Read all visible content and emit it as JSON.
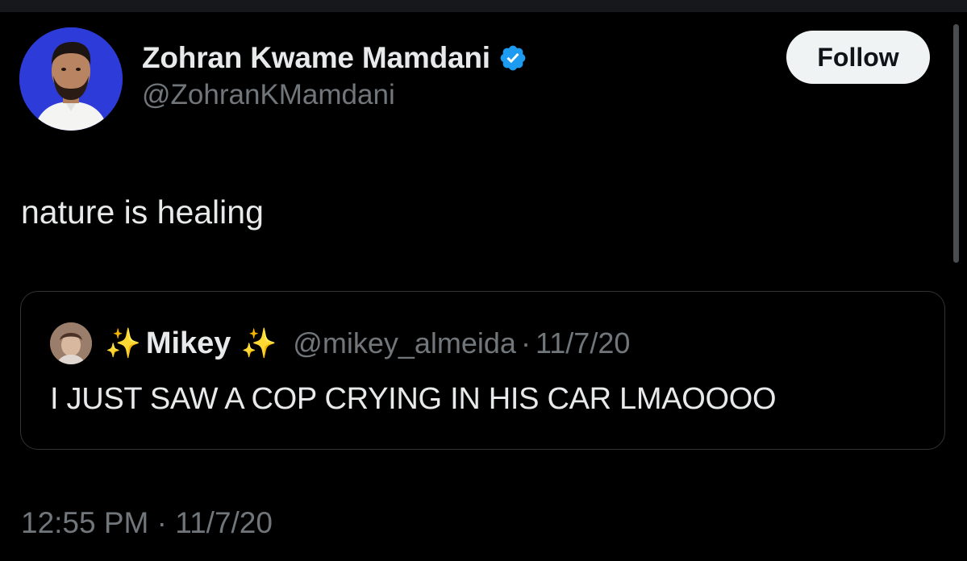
{
  "tweet": {
    "author": {
      "display_name": "Zohran Kwame Mamdani",
      "handle": "@ZohranKMamdani",
      "verified_icon": "verified-badge-icon"
    },
    "follow_label": "Follow",
    "text": "nature is healing",
    "quoted": {
      "sparkle_left": "✨",
      "display_name": "Mikey",
      "sparkle_right": "✨",
      "handle": "@mikey_almeida",
      "separator": "·",
      "date": "11/7/20",
      "text": "I JUST SAW A COP CRYING IN HIS CAR LMAOOOO"
    },
    "time": "12:55 PM",
    "time_separator": "·",
    "date": "11/7/20"
  },
  "colors": {
    "background": "#000000",
    "primary_text": "#e7e9ea",
    "secondary_text": "#71767b",
    "verified": "#1d9bf0",
    "follow_bg": "#eff3f4",
    "avatar_bg": "#2d3bd8"
  }
}
